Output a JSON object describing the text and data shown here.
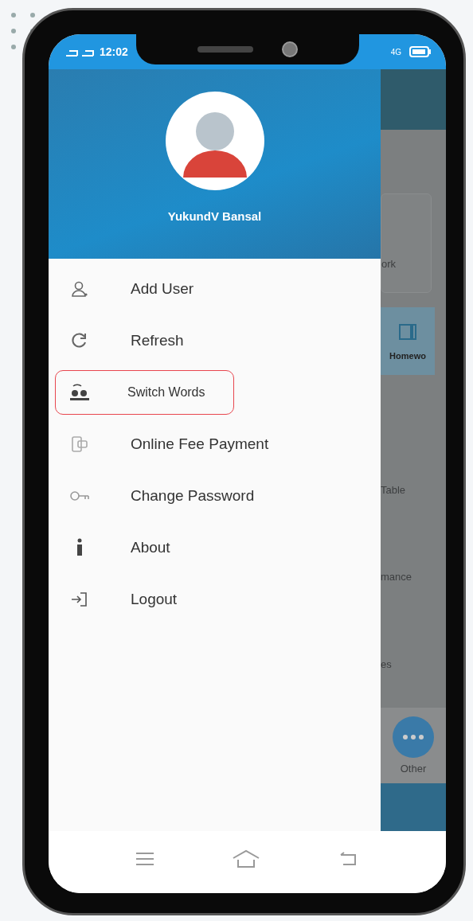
{
  "status_bar": {
    "time": "12:02",
    "network": "4G"
  },
  "profile": {
    "name": "YukundV Bansal"
  },
  "menu": [
    {
      "label": "Add User",
      "kind": "user",
      "selected": false
    },
    {
      "label": "Refresh",
      "kind": "refresh",
      "selected": false
    },
    {
      "label": "Switch Words",
      "kind": "switch",
      "selected": true
    },
    {
      "label": "Online Fee Payment",
      "kind": "payment",
      "selected": false
    },
    {
      "label": "Change Password",
      "kind": "password",
      "selected": false
    },
    {
      "label": "About",
      "kind": "info",
      "selected": false
    },
    {
      "label": "Logout",
      "kind": "logout",
      "selected": false
    }
  ],
  "background_app": {
    "card_label": "ork",
    "tile_label": "Homewo",
    "items": [
      "Table",
      "mance",
      "es"
    ],
    "fab_label": "Other"
  }
}
